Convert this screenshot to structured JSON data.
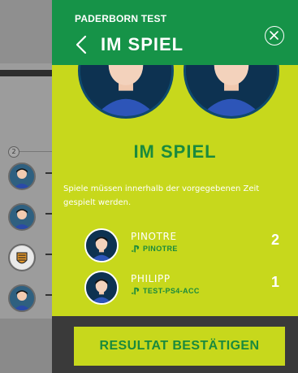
{
  "header": {
    "subtitle": "PADERBORN TEST",
    "title": "IM SPIEL"
  },
  "status": {
    "title": "IM SPIEL",
    "description": "Spiele müssen innerhalb der vorgegebenen Zeit gespielt werden."
  },
  "players": [
    {
      "name": "PINOTRE",
      "platform_icon": "playstation-icon",
      "account": "PINOTRE",
      "score": "2"
    },
    {
      "name": "PHILIPP",
      "platform_icon": "playstation-icon",
      "account": "TEST-PS4-ACC",
      "score": "1"
    }
  ],
  "footer": {
    "confirm_label": "RESULTAT BESTÄTIGEN"
  },
  "background": {
    "list_index": "2"
  },
  "colors": {
    "panel_bg": "#c7d81c",
    "header_bg": "#169348",
    "accent_green": "#1a8a3d",
    "footer_bg": "#3a3a3a",
    "avatar_bg": "#0d3251"
  }
}
